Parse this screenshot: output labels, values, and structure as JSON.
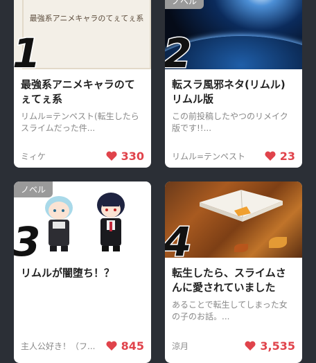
{
  "cards": [
    {
      "rank": "1",
      "badge": "",
      "thumb_text": "最強系アニメキャラのてぇてぇ系",
      "title": "最強系アニメキャラのてぇてぇ系",
      "desc": "リムル=テンペスト(転生したらスライムだった件...",
      "author": "ミィケ",
      "likes": "330"
    },
    {
      "rank": "2",
      "badge": "ノベル",
      "title": "転スラ風邪ネタ(リムル)リムル版",
      "desc": "この前投稿したやつのリメイク版です!!...",
      "author": "リムル=テンペスト",
      "likes": "23"
    },
    {
      "rank": "3",
      "badge": "ノベル",
      "title": "リムルが闇堕ち！？",
      "desc": "",
      "author": "主人公好き！（フ...",
      "likes": "845"
    },
    {
      "rank": "4",
      "badge": "",
      "title": "転生したら、スライムさんに愛されていました",
      "desc": "あることで転生してしまった女の子のお話。...",
      "author": "涼月",
      "likes": "3,535"
    }
  ],
  "colors": {
    "heart": "#e0434b",
    "background": "#2b2f36"
  },
  "icons": {
    "likes": "heart-icon"
  }
}
